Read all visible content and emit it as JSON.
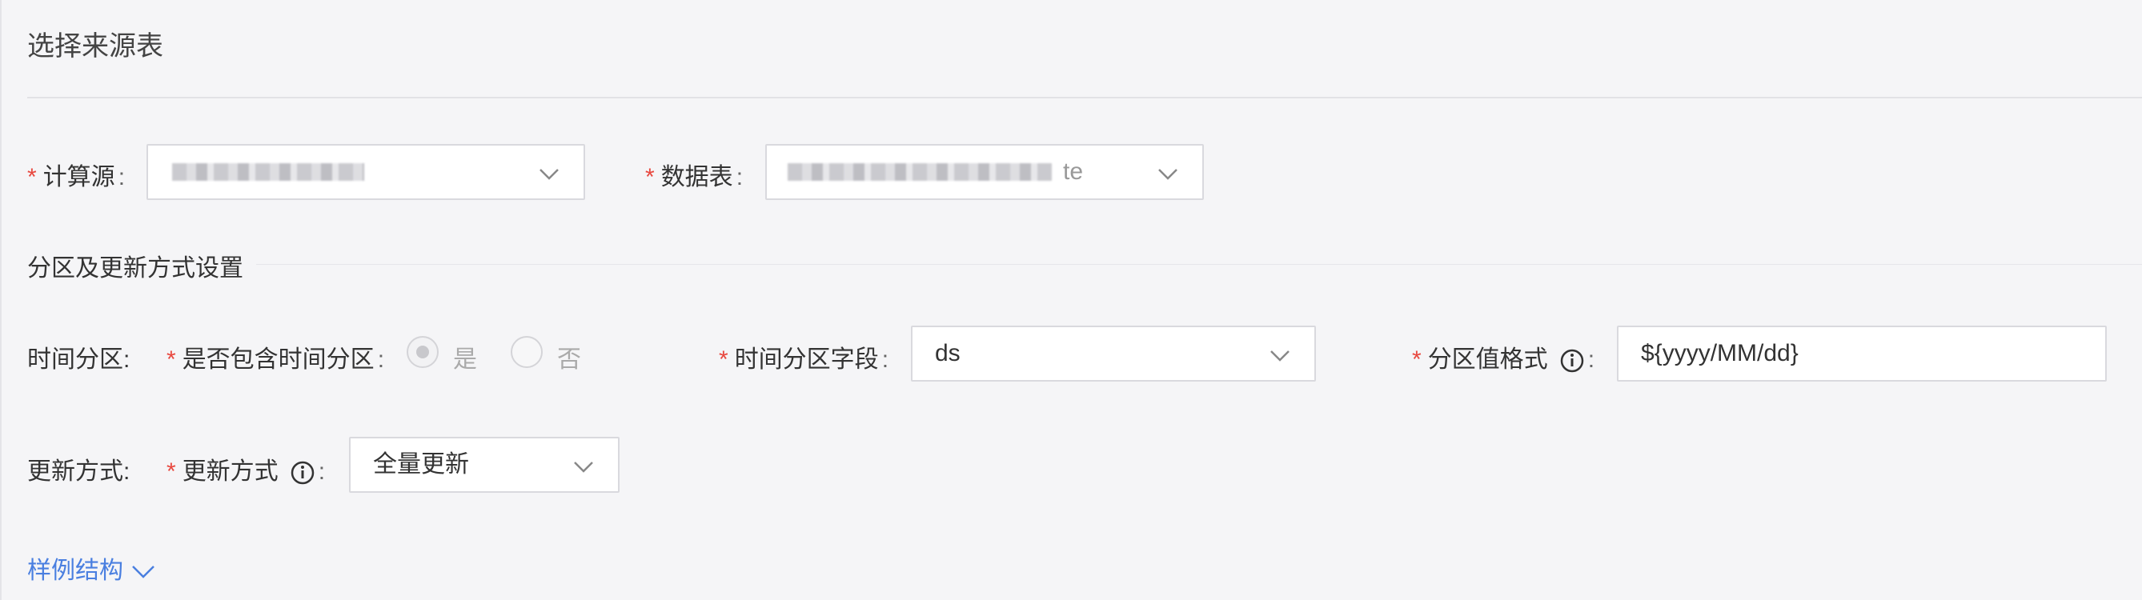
{
  "title": "选择来源表",
  "source": {
    "label": "计算源",
    "colon": ":"
  },
  "table": {
    "label": "数据表",
    "colon": ":",
    "visible_suffix": "te"
  },
  "partition_section": {
    "title": "分区及更新方式设置"
  },
  "time_partition": {
    "row_label": "时间分区:",
    "include_label": "是否包含时间分区",
    "colon": ":",
    "options": [
      "是",
      "否"
    ],
    "selected": "是",
    "field_label": "时间分区字段",
    "field_value": "ds",
    "format_label": "分区值格式",
    "format_value": "${yyyy/MM/dd}"
  },
  "update": {
    "row_label": "更新方式:",
    "mode_label": "更新方式",
    "colon": ":",
    "mode_value": "全量更新"
  },
  "sample_link": "样例结构",
  "colors": {
    "required": "#e8483f",
    "link": "#4a7fe0",
    "border": "#d9d9de",
    "background": "#f5f5f7"
  },
  "icons": [
    "chevron-down-icon",
    "info-circle-icon"
  ]
}
